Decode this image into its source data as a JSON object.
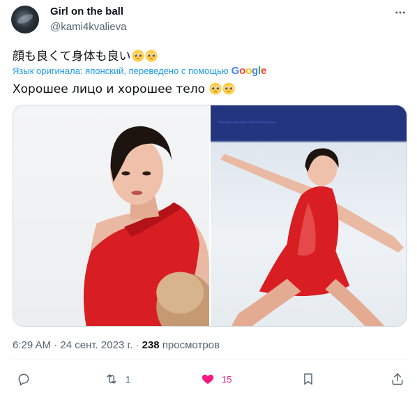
{
  "author": {
    "display_name": "Girl on the ball",
    "handle": "@kami4kvalieva"
  },
  "tweet": {
    "original_text": "顔も良くて身体も良い",
    "translation_note": "Язык оригинала: японский, переведено с помощью",
    "translation_provider": "Google",
    "translated_text": "Хорошее лицо и хорошее тело",
    "emoji": "pleading-face-icon"
  },
  "meta": {
    "time": "6:29 AM",
    "separator": "·",
    "date": "24 сент. 2023 г.",
    "views_count": "238",
    "views_label": "просмотров"
  },
  "actions": {
    "reply_count": "",
    "retweet_count": "1",
    "like_count": "15",
    "bookmark_count": "",
    "like_color": "#f91880"
  },
  "colors": {
    "link_blue": "#1d9bf0",
    "text_secondary": "#536471",
    "dress_red": "#d81e22"
  },
  "media": {
    "photo_left": "figure-skater-portrait",
    "photo_right": "figure-skater-spin"
  }
}
